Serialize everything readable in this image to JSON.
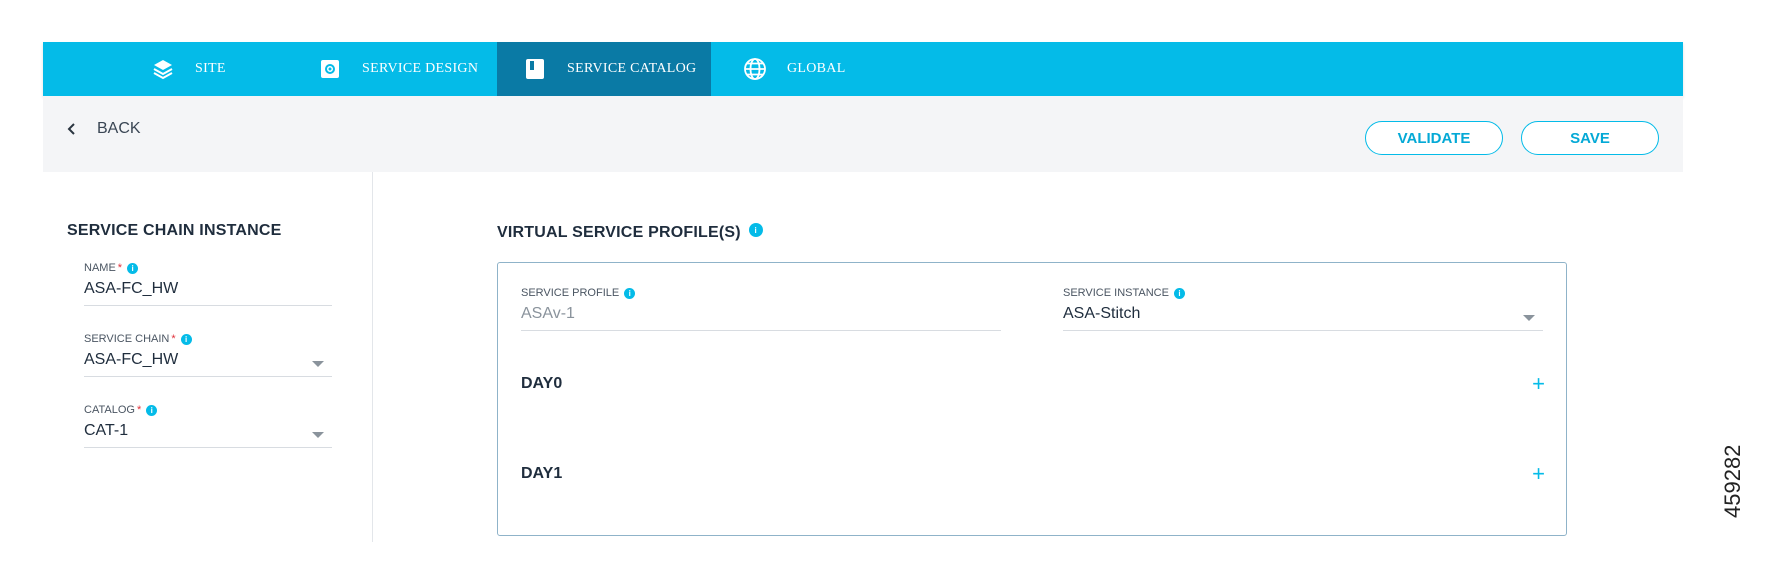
{
  "nav": {
    "tabs": [
      {
        "label": "SITE",
        "icon": "layers-icon"
      },
      {
        "label": "SERVICE DESIGN",
        "icon": "gear-box-icon"
      },
      {
        "label": "SERVICE CATALOG",
        "icon": "book-icon",
        "active": true
      },
      {
        "label": "GLOBAL",
        "icon": "globe-icon"
      }
    ]
  },
  "toolbar": {
    "back_label": "BACK",
    "validate_label": "VALIDATE",
    "save_label": "SAVE"
  },
  "left": {
    "title": "SERVICE CHAIN INSTANCE",
    "name": {
      "label": "NAME",
      "required": "*",
      "value": "ASA-FC_HW"
    },
    "service_chain": {
      "label": "SERVICE CHAIN",
      "required": "*",
      "value": "ASA-FC_HW"
    },
    "catalog": {
      "label": "CATALOG",
      "required": "*",
      "value": "CAT-1"
    }
  },
  "right": {
    "title": "VIRTUAL SERVICE PROFILE(S)",
    "service_profile": {
      "label": "SERVICE PROFILE",
      "value": "ASAv-1"
    },
    "service_instance": {
      "label": "SERVICE INSTANCE",
      "value": "ASA-Stitch"
    },
    "day0": {
      "label": "DAY0",
      "action": "+"
    },
    "day1": {
      "label": "DAY1",
      "action": "+"
    }
  },
  "figure_number": "459282",
  "colors": {
    "accent": "#04bbe8",
    "active_tab": "#0a7aa5",
    "toolbar_bg": "#f4f5f7"
  }
}
